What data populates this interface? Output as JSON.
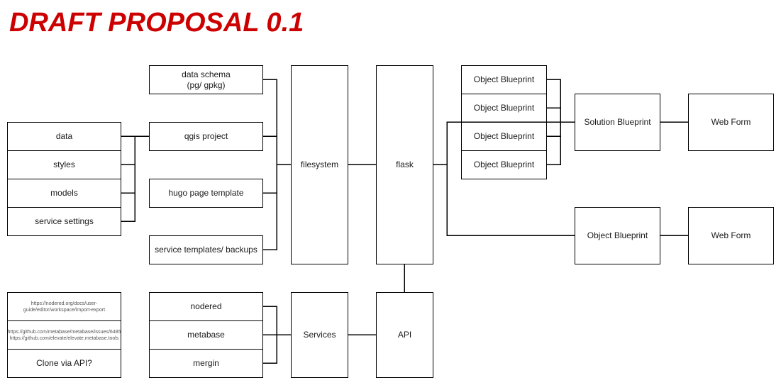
{
  "title": "DRAFT PROPOSAL 0.1",
  "colors": {
    "title": "#cc0000",
    "stroke": "#000000",
    "text": "#1a1a1a",
    "fill": "#ffffff"
  },
  "nodes": {
    "data": "data",
    "styles": "styles",
    "models": "models",
    "service_settings": "service settings",
    "data_schema": "data schema\n(pg/ gpkg)",
    "qgis_project": "qgis project",
    "hugo_page_template": "hugo page template",
    "service_templates": "service templates/ backups",
    "filesystem": "filesystem",
    "flask": "flask",
    "object_blueprint_1": "Object Blueprint",
    "object_blueprint_2": "Object Blueprint",
    "object_blueprint_3": "Object Blueprint",
    "object_blueprint_4": "Object Blueprint",
    "solution_blueprint": "Solution Blueprint",
    "web_form_1": "Web Form",
    "object_blueprint_5": "Object Blueprint",
    "web_form_2": "Web Form",
    "note_nodered_url": "https://nodered.org/docs/user-guide/editor/workspace/import-export",
    "note_metabase_url_1": "https://github.com/metabase/metabase/issues/6485",
    "note_metabase_url_2": "https://github.com/elevate/elevate.metabase.tools",
    "note_clone": "Clone via API?",
    "nodered": "nodered",
    "metabase": "metabase",
    "mergin": "mergin",
    "services": "Services",
    "api": "API"
  },
  "connections": [
    [
      "data",
      "qgis_project"
    ],
    [
      "styles",
      "qgis_project"
    ],
    [
      "models",
      "qgis_project"
    ],
    [
      "service_settings",
      "qgis_project"
    ],
    [
      "data_schema",
      "filesystem"
    ],
    [
      "qgis_project",
      "filesystem"
    ],
    [
      "hugo_page_template",
      "filesystem"
    ],
    [
      "service_templates",
      "filesystem"
    ],
    [
      "filesystem",
      "flask"
    ],
    [
      "flask",
      "solution_blueprint"
    ],
    [
      "flask",
      "object_blueprint_5"
    ],
    [
      "object_blueprint_1",
      "solution_blueprint"
    ],
    [
      "object_blueprint_2",
      "solution_blueprint"
    ],
    [
      "object_blueprint_3",
      "solution_blueprint"
    ],
    [
      "object_blueprint_4",
      "solution_blueprint"
    ],
    [
      "solution_blueprint",
      "web_form_1"
    ],
    [
      "object_blueprint_5",
      "web_form_2"
    ],
    [
      "nodered",
      "services"
    ],
    [
      "metabase",
      "services"
    ],
    [
      "mergin",
      "services"
    ],
    [
      "services",
      "api"
    ],
    [
      "api",
      "flask"
    ]
  ]
}
